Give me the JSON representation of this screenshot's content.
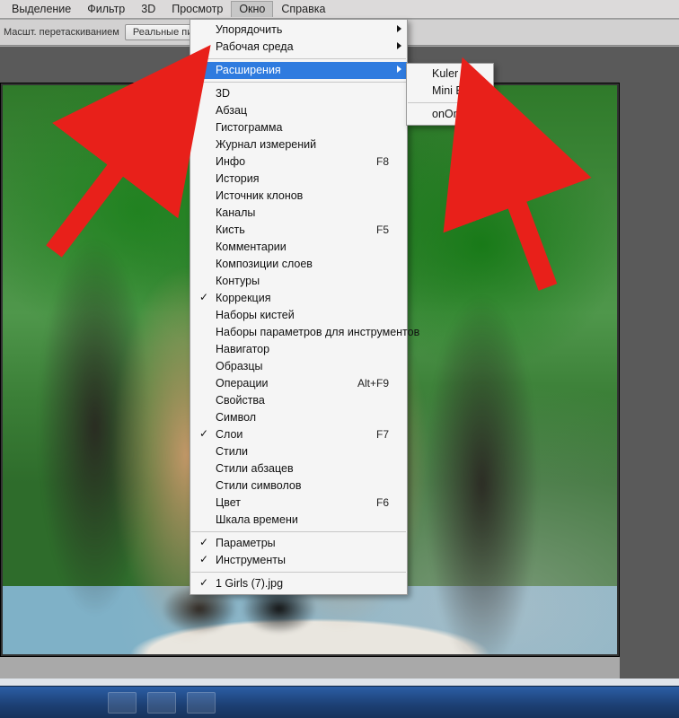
{
  "menubar": {
    "items": [
      "Выделение",
      "Фильтр",
      "3D",
      "Просмотр",
      "Окно",
      "Справка"
    ],
    "active_index": 4
  },
  "optionsbar": {
    "drag_label": "Масшт. перетаскиванием",
    "real_pixels_btn": "Реальные пикселы"
  },
  "window_menu": {
    "group0": [
      {
        "label": "Упорядочить",
        "submenu": true
      },
      {
        "label": "Рабочая среда",
        "submenu": true
      }
    ],
    "group1_highlight": {
      "label": "Расширения",
      "submenu": true
    },
    "group2": [
      {
        "label": "3D"
      },
      {
        "label": "Абзац"
      },
      {
        "label": "Гистограмма"
      },
      {
        "label": "Журнал измерений"
      },
      {
        "label": "Инфо",
        "shortcut": "F8"
      },
      {
        "label": "История"
      },
      {
        "label": "Источник клонов"
      },
      {
        "label": "Каналы"
      },
      {
        "label": "Кисть",
        "shortcut": "F5"
      },
      {
        "label": "Комментарии"
      },
      {
        "label": "Композиции слоев"
      },
      {
        "label": "Контуры"
      },
      {
        "label": "Коррекция",
        "checked": true
      },
      {
        "label": "Наборы кистей"
      },
      {
        "label": "Наборы параметров для инструментов"
      },
      {
        "label": "Навигатор"
      },
      {
        "label": "Образцы"
      },
      {
        "label": "Операции",
        "shortcut": "Alt+F9"
      },
      {
        "label": "Свойства"
      },
      {
        "label": "Символ"
      },
      {
        "label": "Слои",
        "shortcut": "F7",
        "checked": true
      },
      {
        "label": "Стили"
      },
      {
        "label": "Стили абзацев"
      },
      {
        "label": "Стили символов"
      },
      {
        "label": "Цвет",
        "shortcut": "F6"
      },
      {
        "label": "Шкала времени"
      }
    ],
    "group3": [
      {
        "label": "Параметры",
        "checked": true
      },
      {
        "label": "Инструменты",
        "checked": true
      }
    ],
    "group4": [
      {
        "label": "1 Girls (7).jpg",
        "checked": true
      }
    ]
  },
  "submenu": {
    "items": [
      {
        "label": "Kuler"
      },
      {
        "label": "Mini Bridge"
      },
      {
        "label": "onOne",
        "sep_before": true
      }
    ]
  },
  "annotation_color": "#e8201a"
}
